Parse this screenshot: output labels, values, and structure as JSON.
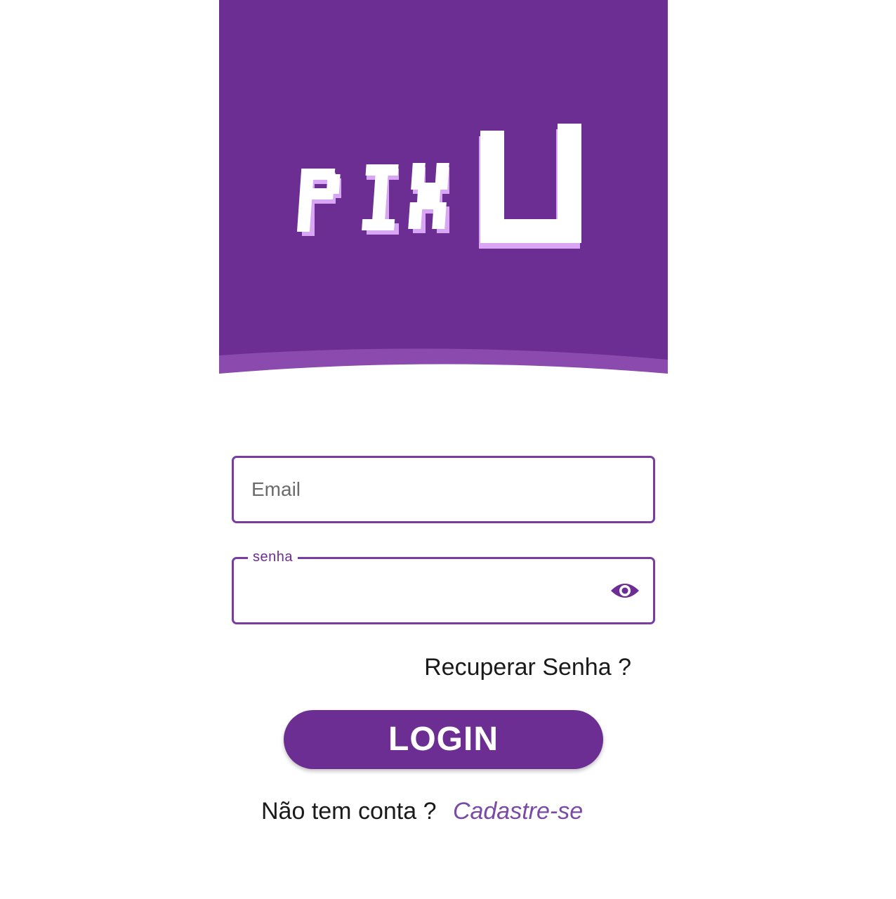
{
  "app": {
    "logo_text": "PIXU",
    "brand_color": "#6c2e92",
    "brand_color_light": "#8a4aae",
    "logo_shadow_color": "#d9a6f5"
  },
  "form": {
    "email": {
      "placeholder": "Email",
      "value": ""
    },
    "password": {
      "label": "senha",
      "value": "",
      "toggle_icon": "eye-icon"
    },
    "recover_link": "Recuperar Senha ?",
    "login_button": "LOGIN"
  },
  "footer": {
    "prompt": "Não tem conta ?",
    "signup_link": "Cadastre-se"
  }
}
